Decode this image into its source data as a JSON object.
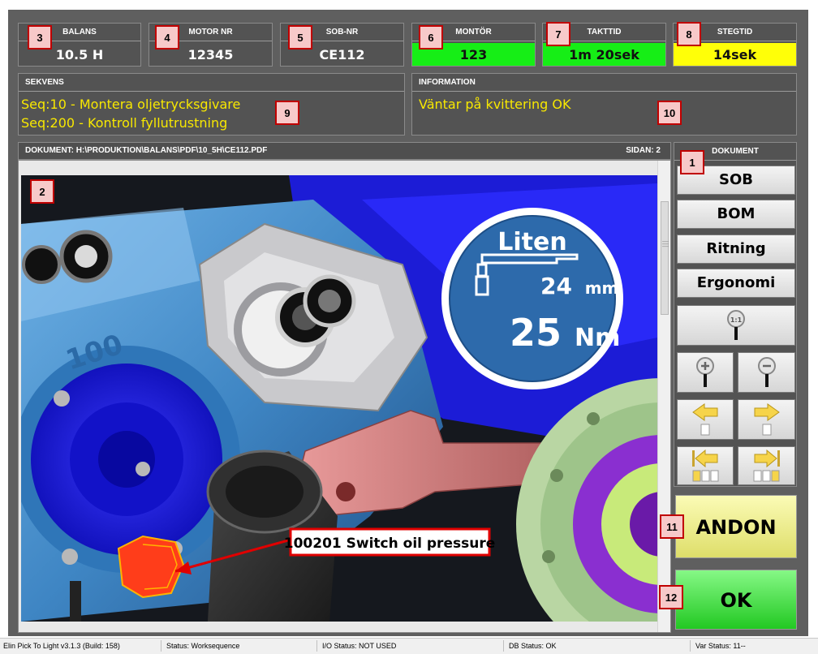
{
  "top_boxes": [
    {
      "label": "BALANS",
      "value": "10.5 H",
      "marker": "3"
    },
    {
      "label": "MOTOR NR",
      "value": "12345",
      "marker": "4"
    },
    {
      "label": "SOB-NR",
      "value": "CE112",
      "marker": "5"
    },
    {
      "label": "MONTÖR",
      "value": "123",
      "marker": "6"
    },
    {
      "label": "TAKTTID",
      "value": "1m 20sek",
      "marker": "7"
    },
    {
      "label": "STEGTID",
      "value": "14sek",
      "marker": "8"
    }
  ],
  "sequence": {
    "label": "SEKVENS",
    "lines": [
      "Seq:10 - Montera oljetrycksgivare",
      "Seq:200 - Kontroll fyllutrustning"
    ],
    "marker": "9"
  },
  "information": {
    "label": "INFORMATION",
    "text": "Väntar på kvittering OK",
    "marker": "10"
  },
  "document": {
    "path_label": "DOKUMENT: H:\\PRODUKTION\\BALANS\\PDF\\10_5H\\CE112.PDF",
    "page_label": "SIDAN: 2",
    "marker": "2",
    "callout": "100201 Switch oil pressure",
    "torque_sign": {
      "size_word": "Liten",
      "socket": "24",
      "socket_unit": "mm",
      "torque": "25",
      "torque_unit": "Nm"
    }
  },
  "sidebar": {
    "title": "DOKUMENT",
    "marker": "1",
    "buttons": [
      "SOB",
      "BOM",
      "Ritning",
      "Ergonomi"
    ],
    "zoom_fit_label": "1:1"
  },
  "actions": {
    "andon_label": "ANDON",
    "andon_marker": "11",
    "ok_label": "OK",
    "ok_marker": "12"
  },
  "statusbar": {
    "version": "Elin Pick To Light v3.1.3 (Build: 158)",
    "status": "Status: Worksequence",
    "io_status": "I/O Status: NOT USED",
    "db_status": "DB Status: OK",
    "var_status": "Var Status: 11--"
  },
  "colors": {
    "green": "#16ee16",
    "yellow": "#ffff08",
    "andon": "#eaea80",
    "ok": "#33d633"
  }
}
